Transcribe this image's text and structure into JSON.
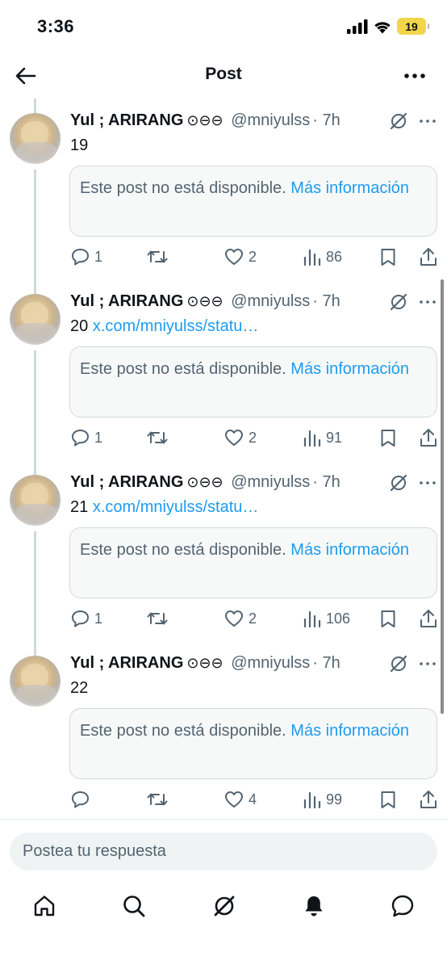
{
  "status_bar": {
    "time": "3:36",
    "battery": "19",
    "icons": [
      "signal-icon",
      "wifi-icon",
      "battery-icon"
    ]
  },
  "header": {
    "title": "Post",
    "back_icon": "arrow-left-icon",
    "more_icon": "more-horizontal-icon"
  },
  "posts": [
    {
      "author": "Yul ; ARIRANG",
      "badges": "⊙⊖⊖",
      "handle": "@mniyulss",
      "time": "· 7h",
      "text": "19",
      "link": "",
      "unavailable_text": "Este post no está disponible.",
      "unavailable_link": "Más información",
      "replies": "1",
      "reposts": "",
      "likes": "2",
      "views": "86"
    },
    {
      "author": "Yul ; ARIRANG",
      "badges": "⊙⊖⊖",
      "handle": "@mniyulss",
      "time": "· 7h",
      "text": "20",
      "link": "x.com/mniyulss/statu…",
      "unavailable_text": "Este post no está disponible.",
      "unavailable_link": "Más información",
      "replies": "1",
      "reposts": "",
      "likes": "2",
      "views": "91"
    },
    {
      "author": "Yul ; ARIRANG",
      "badges": "⊙⊖⊖",
      "handle": "@mniyulss",
      "time": "· 7h",
      "text": "21",
      "link": "x.com/mniyulss/statu…",
      "unavailable_text": "Este post no está disponible.",
      "unavailable_link": "Más información",
      "replies": "1",
      "reposts": "",
      "likes": "2",
      "views": "106"
    },
    {
      "author": "Yul ; ARIRANG",
      "badges": "⊙⊖⊖",
      "handle": "@mniyulss",
      "time": "· 7h",
      "text": "22",
      "link": "",
      "unavailable_text": "Este post no está disponible.",
      "unavailable_link": "Más información",
      "replies": "",
      "reposts": "",
      "likes": "4",
      "views": "99"
    }
  ],
  "composer": {
    "placeholder": "Postea tu respuesta"
  },
  "bottom_nav": [
    "home-icon",
    "search-icon",
    "grok-icon",
    "notifications-icon",
    "messages-icon"
  ],
  "colors": {
    "accent": "#1d9bf0",
    "secondary_text": "#536471",
    "battery": "#f1d64b"
  }
}
